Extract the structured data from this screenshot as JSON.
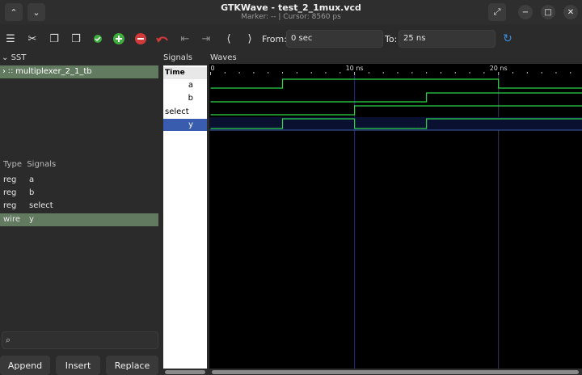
{
  "window": {
    "title": "GTKWave - test_2_1mux.vcd",
    "subtitle": "Marker: --  |  Cursor: 8560 ps"
  },
  "toolbar": {
    "from_label": "From:",
    "from_value": "0 sec",
    "to_label": "To:",
    "to_value": "25 ns"
  },
  "sst": {
    "title": "SST",
    "tree_item": "multiplexer_2_1_tb"
  },
  "signal_list": {
    "headers": {
      "type": "Type",
      "signals": "Signals"
    },
    "rows": [
      {
        "type": "reg",
        "name": "a"
      },
      {
        "type": "reg",
        "name": "b"
      },
      {
        "type": "reg",
        "name": "select"
      },
      {
        "type": "wire",
        "name": "y"
      }
    ]
  },
  "buttons": {
    "append": "Append",
    "insert": "Insert",
    "replace": "Replace"
  },
  "signals_panel": {
    "title": "Signals",
    "time_label": "Time",
    "names": [
      "a",
      "b",
      "select",
      "y"
    ]
  },
  "waves_panel": {
    "title": "Waves",
    "tick_labels": [
      "0",
      "10 ns",
      "20 ns"
    ],
    "tick_times_ns": [
      0,
      10,
      20
    ],
    "view_end_ns": 25.8,
    "cursor_ns": 10,
    "marker_ns": 20,
    "transitions_ns": {
      "a": {
        "initial": 0,
        "toggles": [
          5,
          20
        ]
      },
      "b": {
        "initial": 0,
        "toggles": [
          15
        ]
      },
      "select": {
        "initial": 0,
        "toggles": [
          10
        ]
      },
      "y": {
        "initial": 0,
        "toggles": [
          5,
          10,
          15
        ]
      }
    }
  },
  "colors": {
    "wave_green": "#2fd44a",
    "selection_bg": "#627a60",
    "cursor_line": "#3030ff",
    "y_highlight": "#3a5cae"
  }
}
